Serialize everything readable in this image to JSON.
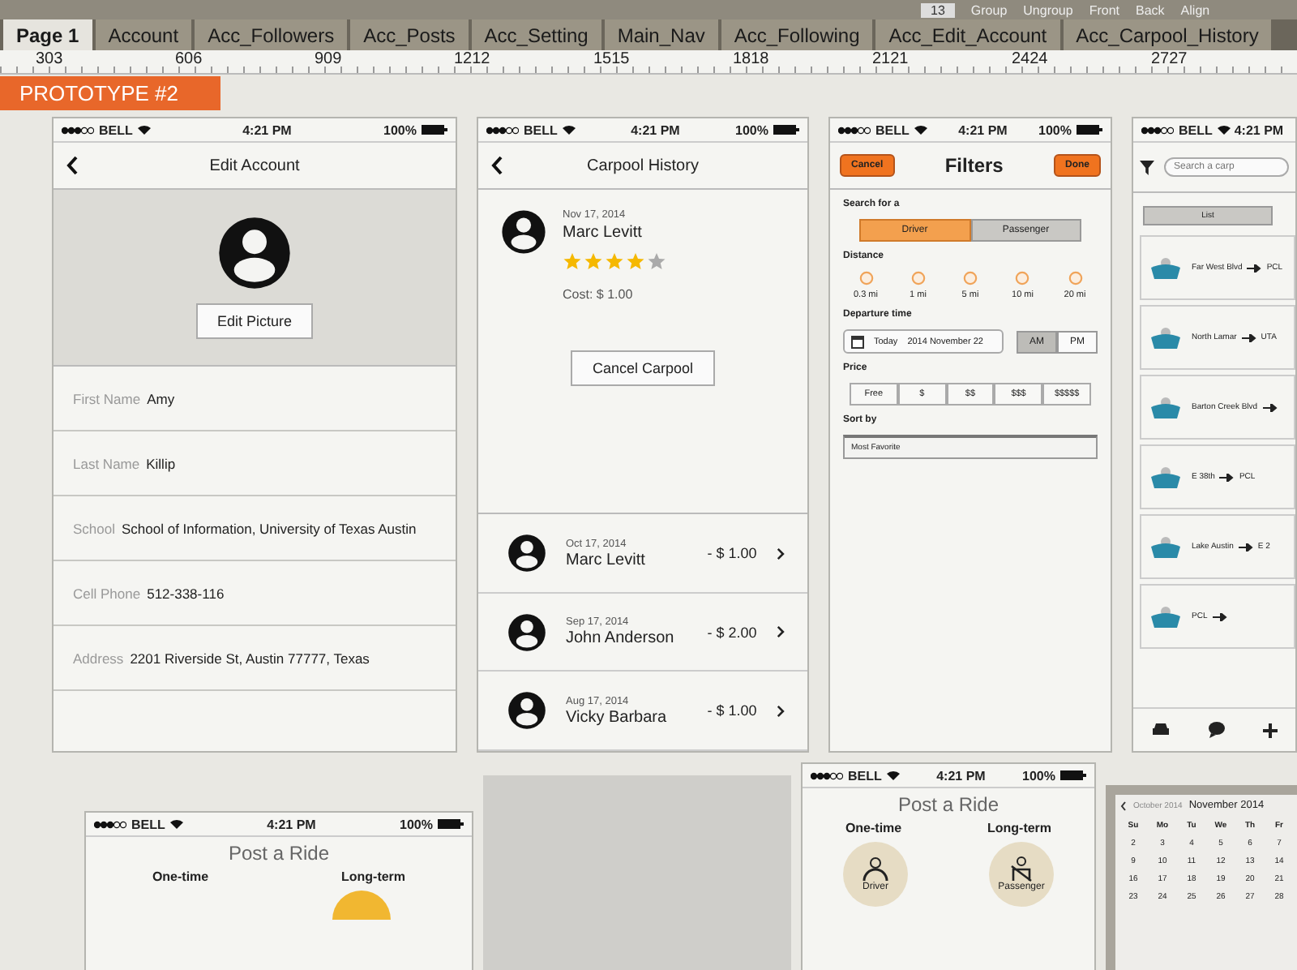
{
  "toolbar": {
    "font_size": "13",
    "actions": [
      "Group",
      "Ungroup",
      "Front",
      "Back",
      "Align"
    ]
  },
  "tabs": [
    {
      "label": "Page 1",
      "selected": true
    },
    {
      "label": "Account",
      "selected": false
    },
    {
      "label": "Acc_Followers",
      "selected": false
    },
    {
      "label": "Acc_Posts",
      "selected": false
    },
    {
      "label": "Acc_Setting",
      "selected": false
    },
    {
      "label": "Main_Nav",
      "selected": false
    },
    {
      "label": "Acc_Following",
      "selected": false
    },
    {
      "label": "Acc_Edit_Account",
      "selected": false
    },
    {
      "label": "Acc_Carpool_History",
      "selected": false
    }
  ],
  "ruler": [
    "303",
    "606",
    "909",
    "1212",
    "1515",
    "1818",
    "2121",
    "2424",
    "2727"
  ],
  "banner": "PROTOTYPE #2",
  "edit_account": {
    "status": {
      "carrier": "BELL",
      "time": "4:21 PM",
      "battery": "100%"
    },
    "title": "Edit Account",
    "edit_picture": "Edit Picture",
    "fields": [
      {
        "label": "First Name",
        "value": "Amy"
      },
      {
        "label": "Last Name",
        "value": "Killip"
      },
      {
        "label": "School",
        "value": "School of Information, University of Texas Austin"
      },
      {
        "label": "Cell Phone",
        "value": "512-338-116"
      },
      {
        "label": "Address",
        "value": "2201 Riverside St, Austin 77777, Texas"
      }
    ]
  },
  "carpool_history": {
    "status": {
      "carrier": "BELL",
      "time": "4:21 PM",
      "battery": "100%"
    },
    "title": "Carpool History",
    "current": {
      "date": "Nov 17, 2014",
      "name": "Marc Levitt",
      "stars": 4,
      "cost": "Cost: $ 1.00",
      "button": "Cancel Carpool"
    },
    "rows": [
      {
        "date": "Oct 17, 2014",
        "name": "Marc Levitt",
        "amount": "- $ 1.00"
      },
      {
        "date": "Sep 17, 2014",
        "name": "John Anderson",
        "amount": "- $ 2.00"
      },
      {
        "date": "Aug 17, 2014",
        "name": "Vicky Barbara",
        "amount": "- $ 1.00"
      }
    ]
  },
  "filters": {
    "status": {
      "carrier": "BELL",
      "time": "4:21 PM",
      "battery": "100%"
    },
    "cancel": "Cancel",
    "title": "Filters",
    "done": "Done",
    "search_label": "Search for a",
    "roles": [
      {
        "label": "Driver",
        "selected": true
      },
      {
        "label": "Passenger",
        "selected": false
      }
    ],
    "distance_label": "Distance",
    "distances": [
      "0.3 mi",
      "1 mi",
      "5 mi",
      "10 mi",
      "20 mi"
    ],
    "departure_label": "Departure time",
    "date_day": "Today",
    "date_value": "2014 November 22",
    "periods": [
      {
        "label": "AM",
        "selected": true
      },
      {
        "label": "PM",
        "selected": false
      }
    ],
    "price_label": "Price",
    "prices": [
      "Free",
      "$",
      "$$",
      "$$$",
      "$$$$$"
    ],
    "sort_label": "Sort by",
    "sort_value": "Most Favorite"
  },
  "carpool_list": {
    "status": {
      "carrier": "BELL",
      "time": "4:21 PM"
    },
    "search_placeholder": "Search a carp",
    "view_tab": "List",
    "routes": [
      {
        "from": "Far West Blvd",
        "to": "PCL"
      },
      {
        "from": "North Lamar",
        "to": "UTA"
      },
      {
        "from": "Barton Creek Blvd"
      },
      {
        "from": "E 38th",
        "to": "PCL"
      },
      {
        "from": "Lake Austin",
        "to": "E 2"
      },
      {
        "from": "PCL"
      }
    ]
  },
  "post_ride_left": {
    "status": {
      "carrier": "BELL",
      "time": "4:21 PM",
      "battery": "100%"
    },
    "title": "Post a Ride",
    "one_time": "One-time",
    "long_term": "Long-term"
  },
  "post_ride_right": {
    "status": {
      "carrier": "BELL",
      "time": "4:21 PM",
      "battery": "100%"
    },
    "title": "Post a Ride",
    "one_time": "One-time",
    "long_term": "Long-term",
    "driver": "Driver",
    "passenger": "Passenger"
  },
  "calendar": {
    "prev": "October 2014",
    "current": "November 2014",
    "weekdays": [
      "Su",
      "Mo",
      "Tu",
      "We",
      "Th",
      "Fr"
    ],
    "weeks": [
      [
        "2",
        "3",
        "4",
        "5",
        "6",
        "7"
      ],
      [
        "9",
        "10",
        "11",
        "12",
        "13",
        "14"
      ],
      [
        "16",
        "17",
        "18",
        "19",
        "20",
        "21"
      ],
      [
        "23",
        "24",
        "25",
        "26",
        "27",
        "28"
      ]
    ]
  }
}
